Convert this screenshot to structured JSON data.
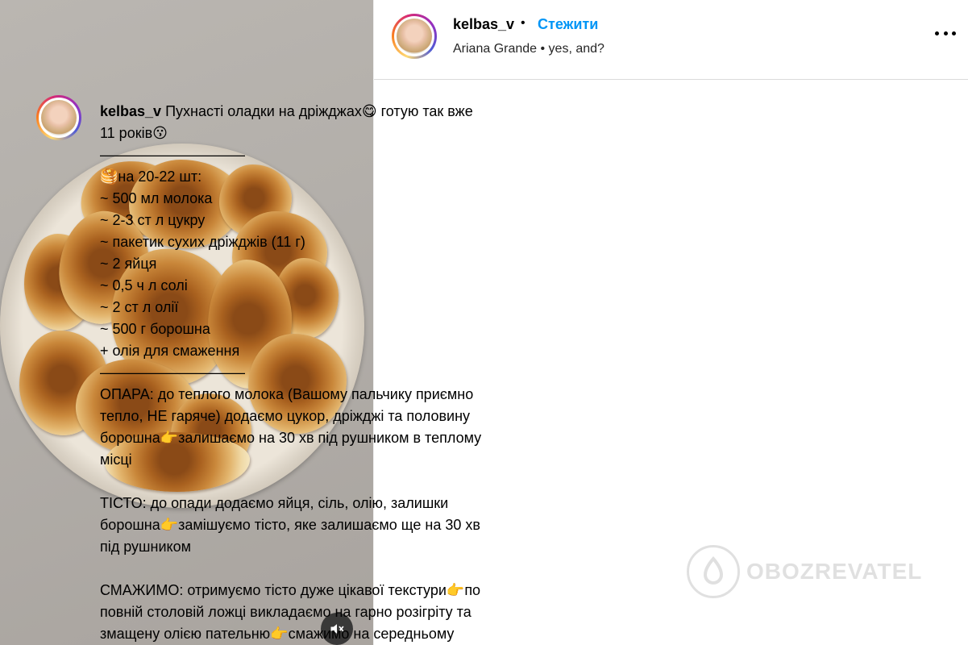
{
  "header": {
    "username": "kelbas_v",
    "separator": "•",
    "follow_label": "Стежити",
    "song": "Ariana Grande • yes, and?",
    "more_icon": "more-horizontal-icon"
  },
  "media": {
    "mute_icon": "speaker-muted-icon"
  },
  "caption": {
    "username": "kelbas_v",
    "title_text": "Пухнасті оладки на дріжджах",
    "title_emoji": "😋",
    "title_rest": "готую так вже",
    "title_line2": "11 років",
    "title_emoji2": "😗",
    "divider": "——————————",
    "yield_emoji": "🥞",
    "yield": "на 20-22 шт:",
    "ingredients": [
      "~ 500 мл молока",
      "~ 2-3 ст л цукру",
      "~ пакетик сухих дріжджів (11 г)",
      "~ 2 яйця",
      "~ 0,5 ч л солі",
      "~ 2 ст л олії",
      "~ 500 г борошна",
      "+ олія для смаження"
    ],
    "divider2": "——————————",
    "step1_line1": "ОПАРА: до теплого молока (Вашому пальчику приємно",
    "step1_line2": "тепло, НЕ гаряче) додаємо цукор, дріжджі та половину",
    "step1_line3a": "борошна",
    "step1_line3b": "залишаємо на 30 хв під рушником в теплому",
    "step1_line4": "місці",
    "step2_line1": "ТІСТО: до опади додаємо яйця, сіль, олію, залишки",
    "step2_line2a": "борошна",
    "step2_line2b": "замішуємо тісто, яке залишаємо ще на 30 хв",
    "step2_line3": "під рушником",
    "step3_line1a": "СМАЖИМО: отримуємо тісто дуже цікавої текстури",
    "step3_line1b": "по",
    "step3_line2": "повній столовій ложці викладаємо на гарно розігріту та",
    "step3_line3a": "змащену олією пательню",
    "step3_line3b": "смажимо на середньому",
    "pointer_emoji": "👉"
  },
  "watermark": {
    "text": "OBOZREVATEL"
  }
}
